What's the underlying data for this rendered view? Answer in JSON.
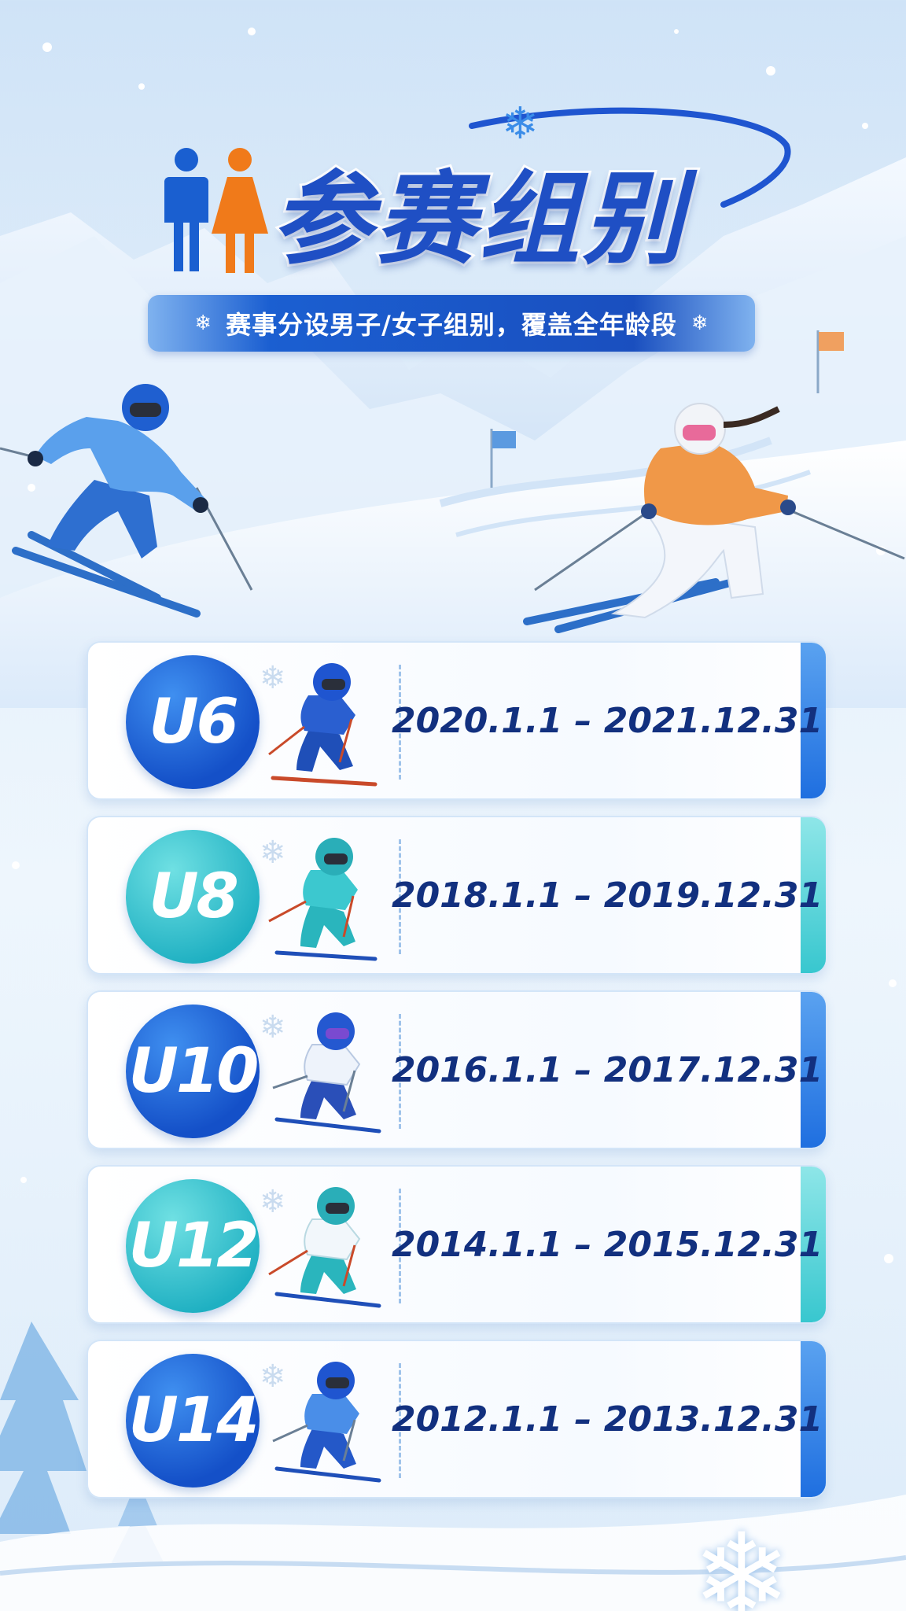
{
  "header": {
    "title": "参赛组别",
    "subtitle": "赛事分设男子/女子组别，覆盖全年龄段",
    "people_icon": "male-female-icon",
    "snowflake_icon": "snowflake-icon"
  },
  "colors": {
    "primary_blue": "#1f4fc4",
    "teal": "#38c7cf",
    "date_text": "#12307f",
    "male_icon": "#1a5fd0",
    "female_icon": "#f07a1a"
  },
  "groups": [
    {
      "code": "U6",
      "dates": "2020.1.1 – 2021.12.31",
      "style": "blue"
    },
    {
      "code": "U8",
      "dates": "2018.1.1 – 2019.12.31",
      "style": "teal"
    },
    {
      "code": "U10",
      "dates": "2016.1.1 – 2017.12.31",
      "style": "blue"
    },
    {
      "code": "U12",
      "dates": "2014.1.1 – 2015.12.31",
      "style": "teal"
    },
    {
      "code": "U14",
      "dates": "2012.1.1 – 2013.12.31",
      "style": "blue"
    }
  ]
}
